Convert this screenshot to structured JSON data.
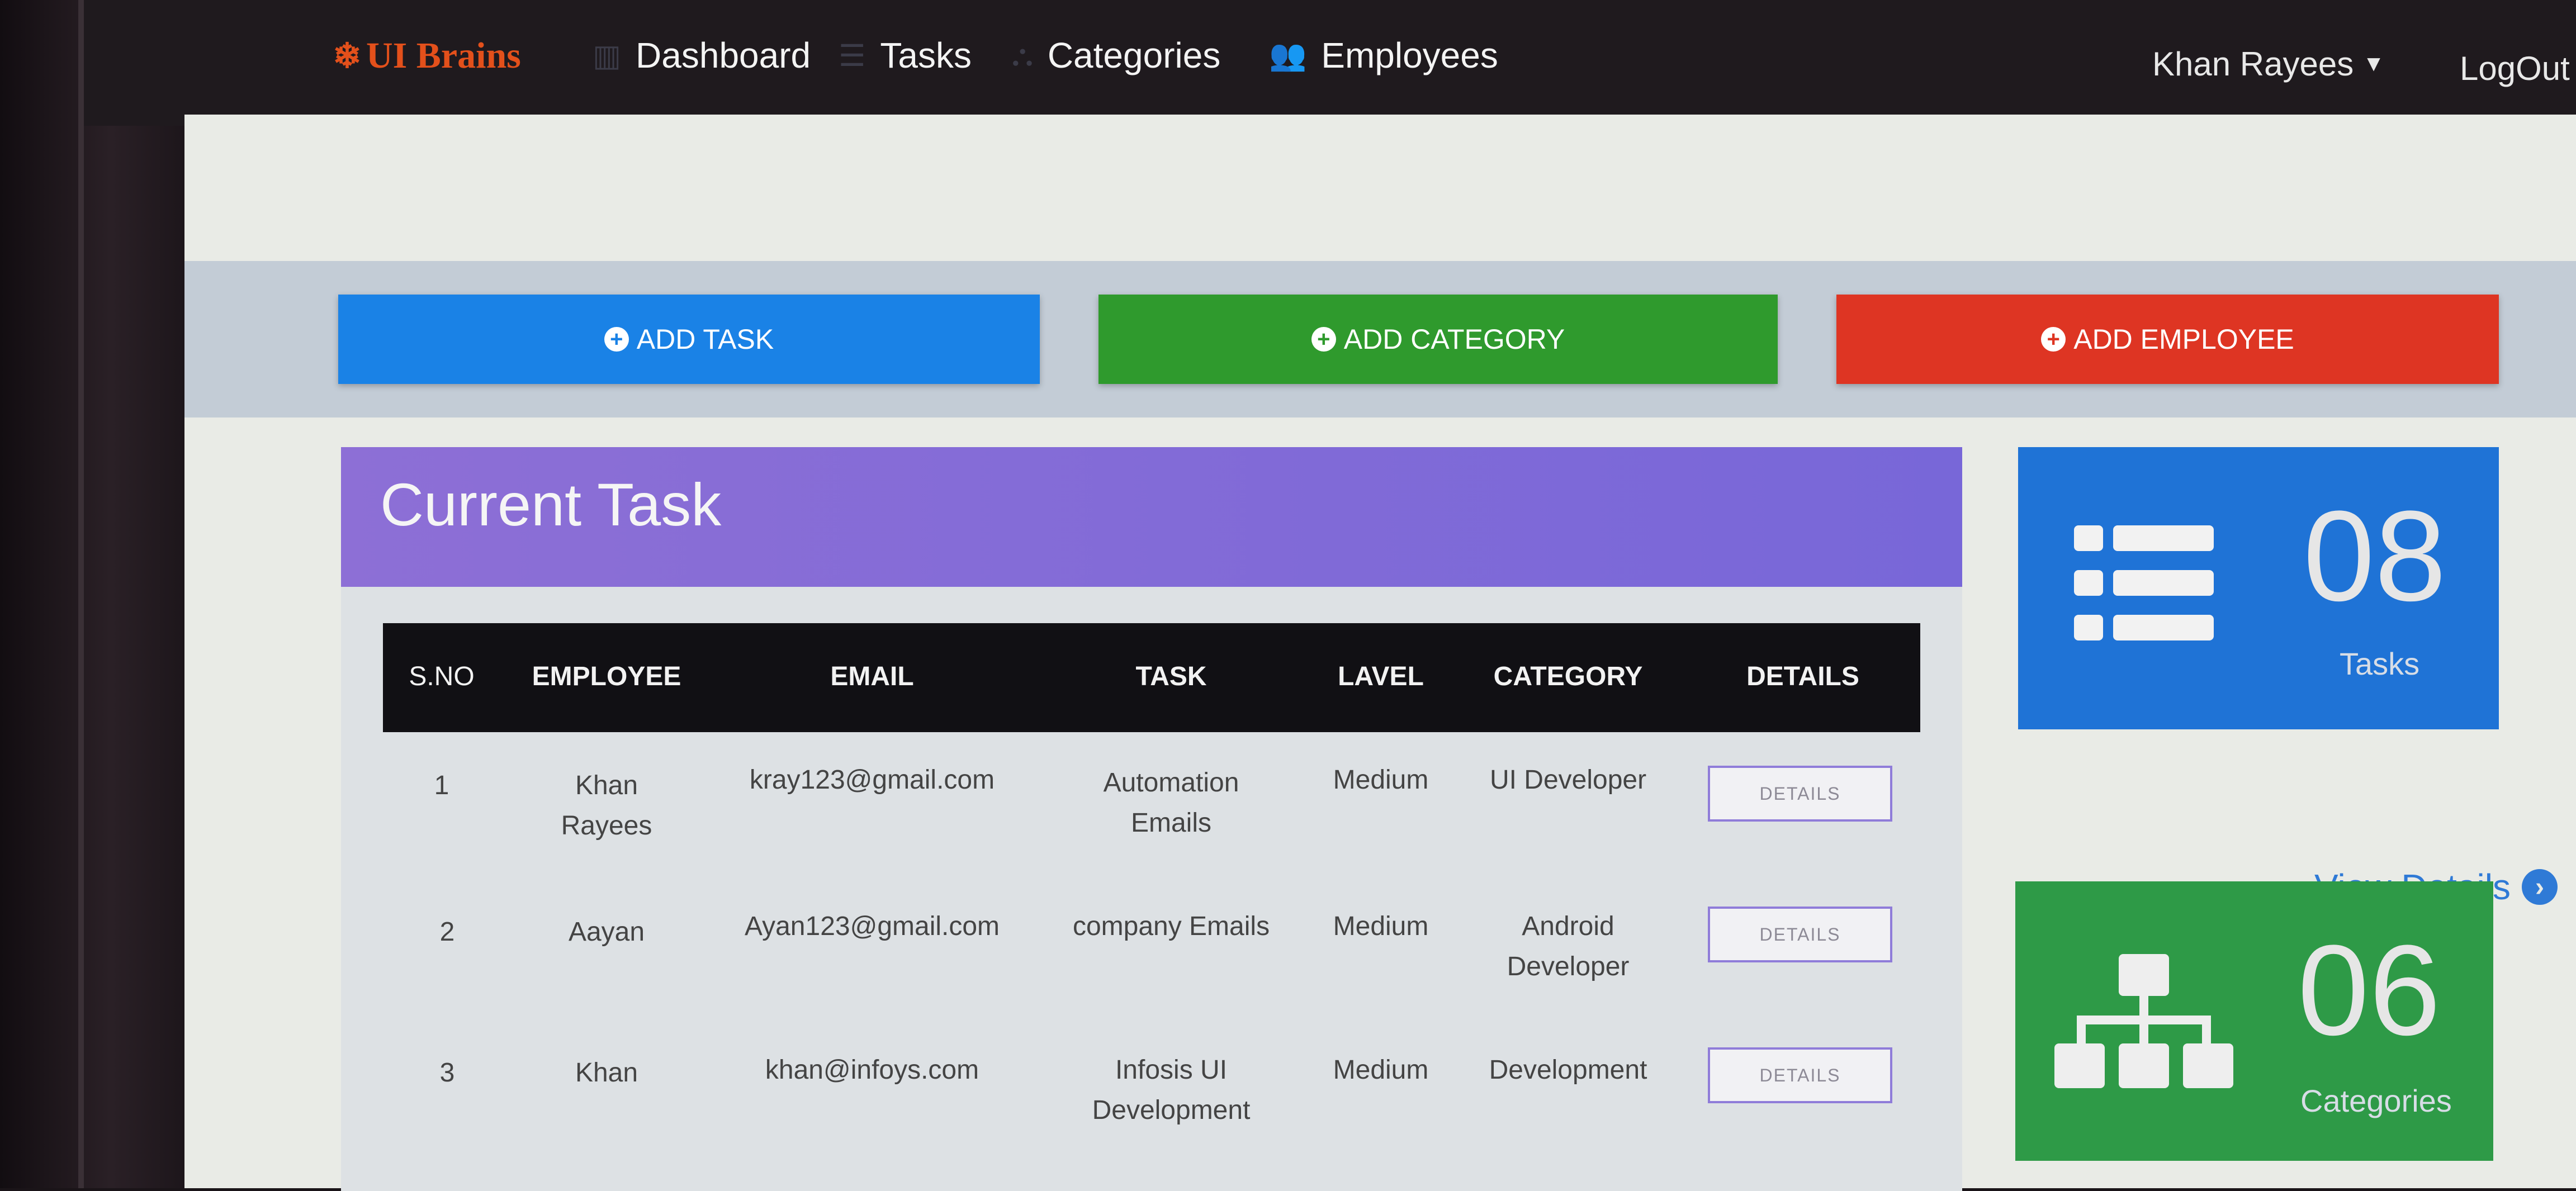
{
  "nav": {
    "brand": "UI Brains",
    "items": [
      {
        "label": "Dashboard",
        "icon": "dashboard-icon"
      },
      {
        "label": "Tasks",
        "icon": "tasks-icon"
      },
      {
        "label": "Categories",
        "icon": "sitemap-icon"
      },
      {
        "label": "Employees",
        "icon": "users-icon"
      }
    ],
    "user": "Khan Rayees",
    "logout": "LogOut"
  },
  "actions": {
    "add_task": "ADD TASK",
    "add_category": "ADD CATEGORY",
    "add_employee": "ADD EMPLOYEE"
  },
  "current_task": {
    "title": "Current Task",
    "columns": [
      "S.NO",
      "EMPLOYEE",
      "EMAIL",
      "TASK",
      "LAVEL",
      "CATEGORY",
      "DETAILS"
    ],
    "rows": [
      {
        "sno": "1",
        "employee": "Khan Rayees",
        "email": "kray123@gmail.com",
        "task": "Automation Emails",
        "level": "Medium",
        "category": "UI Developer",
        "details": "DETAILS"
      },
      {
        "sno": "2",
        "employee": "Aayan",
        "email": "Ayan123@gmail.com",
        "task": "company Emails",
        "level": "Medium",
        "category": "Android Developer",
        "details": "DETAILS"
      },
      {
        "sno": "3",
        "employee": "Khan",
        "email": "khan@infoys.com",
        "task": "Infosis UI Development",
        "level": "Medium",
        "category": "Development",
        "details": "DETAILS"
      }
    ]
  },
  "stats": {
    "tasks": {
      "count": "08",
      "label": "Tasks",
      "color": "#1f73d6"
    },
    "categories": {
      "count": "06",
      "label": "Categories",
      "color": "#2e9a47"
    },
    "view_details": "View Details"
  },
  "colors": {
    "navbar": "#1f1a1e",
    "brand": "#e3501b",
    "add_task": "#1a82e6",
    "add_category": "#2f9a2d",
    "add_employee": "#de3523",
    "task_header": "#8069d8"
  }
}
